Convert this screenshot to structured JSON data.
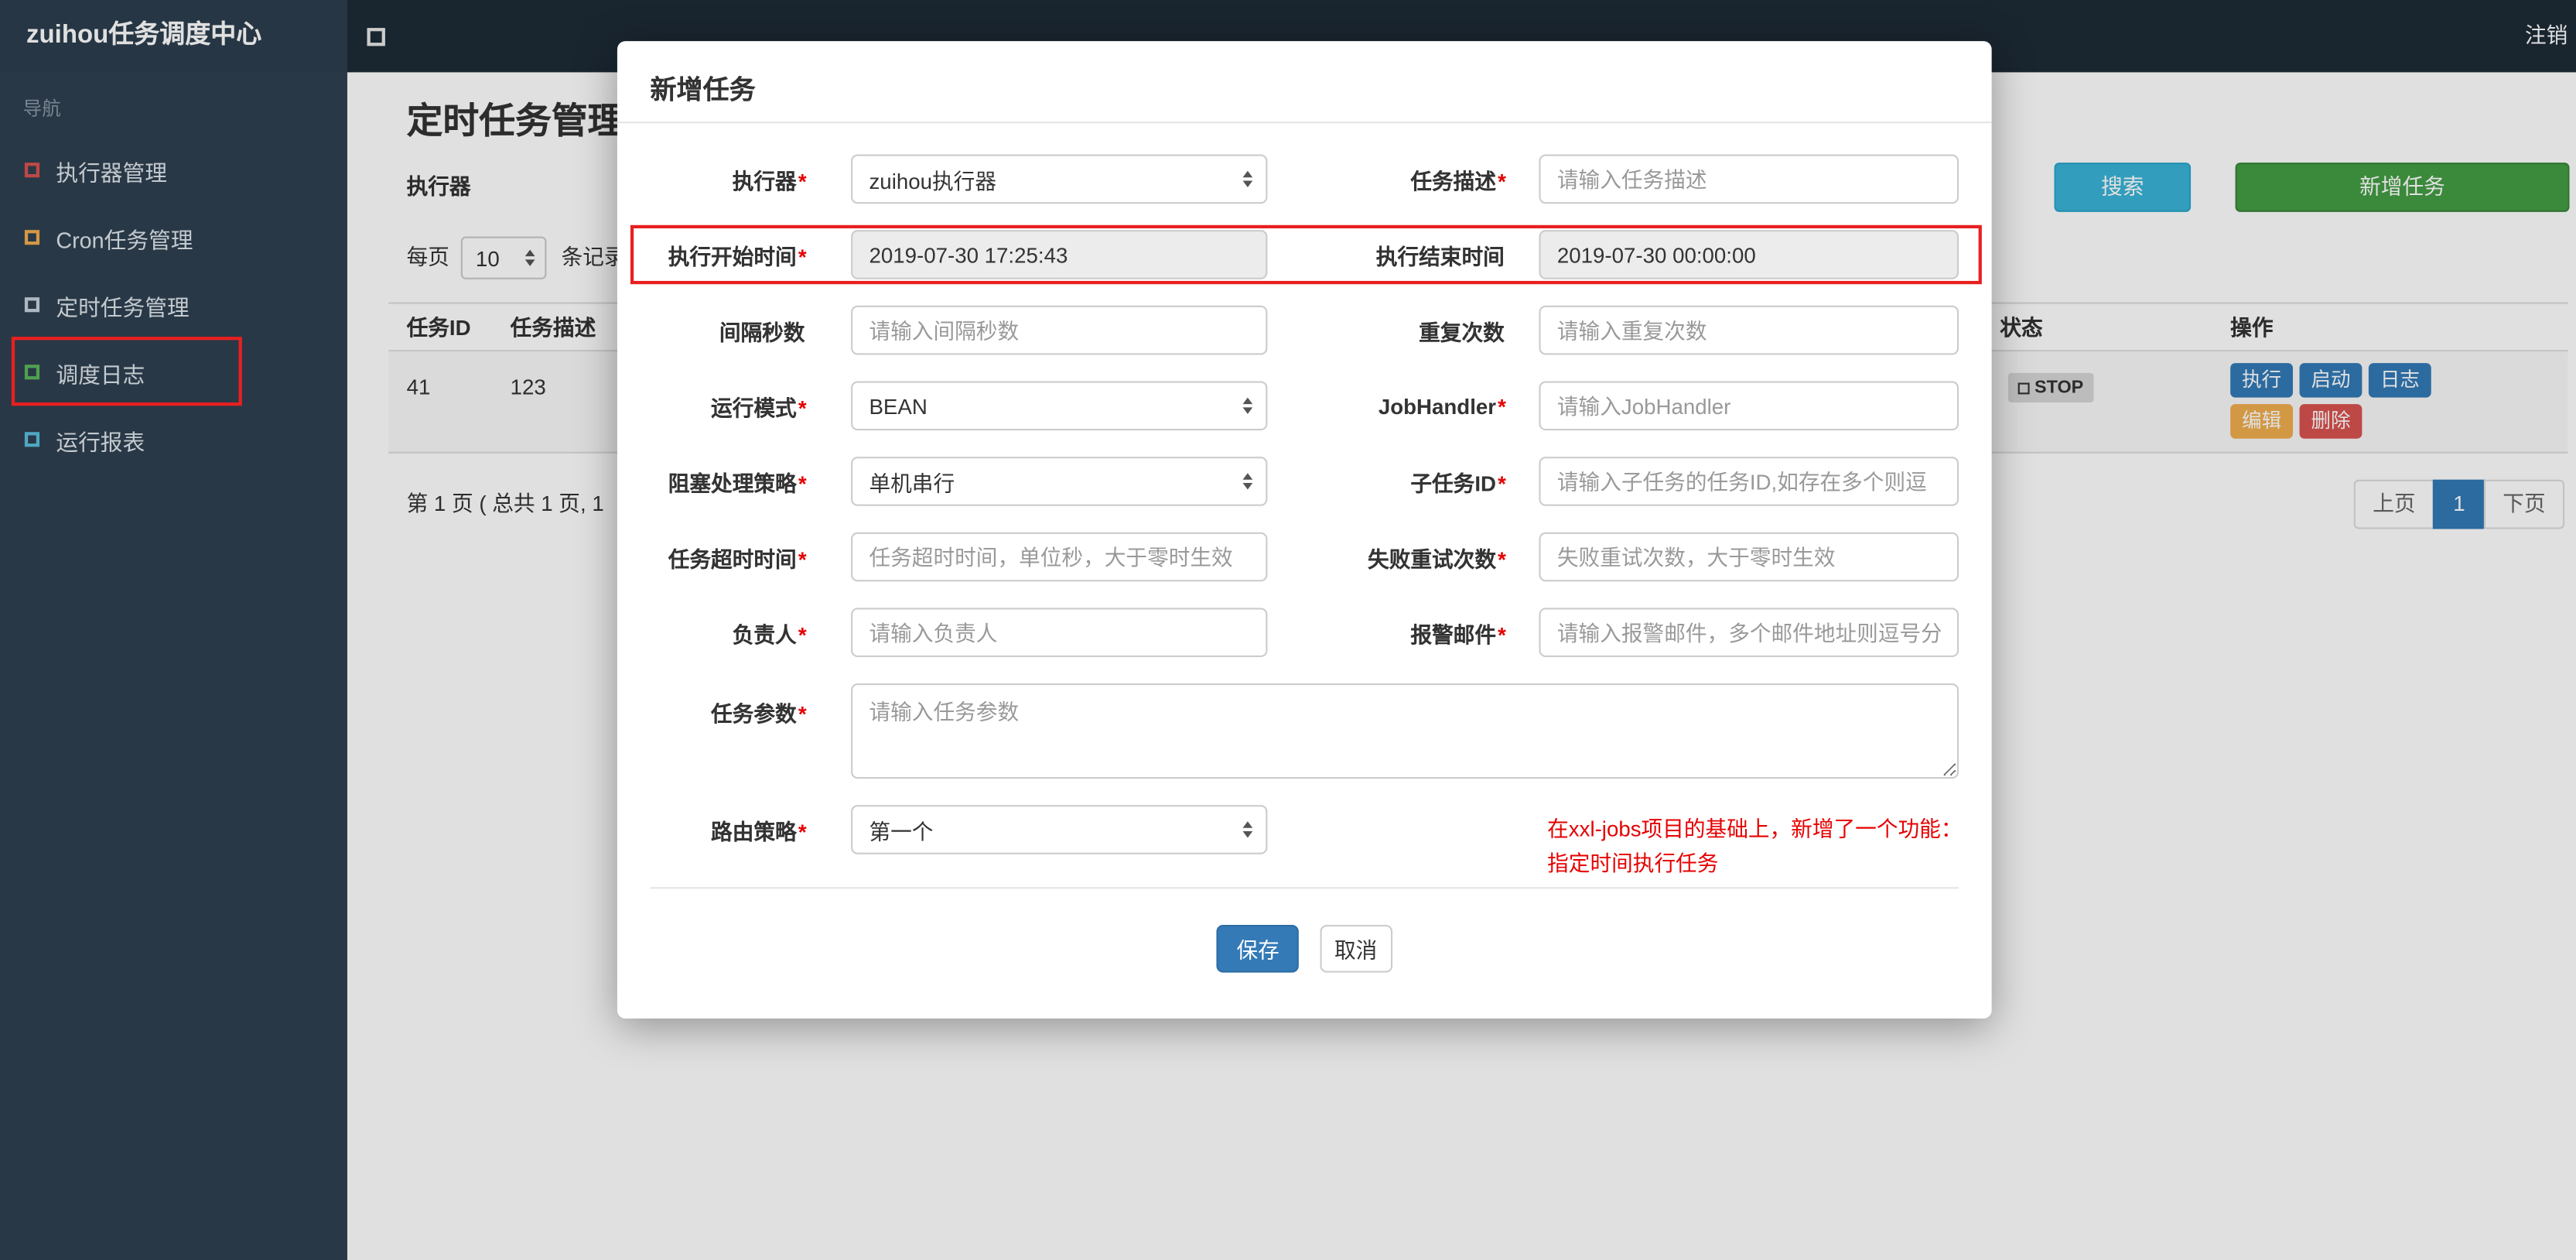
{
  "palette": {
    "navbar_bg": "#1d2b36",
    "brand_bg": "#2c3e4e",
    "sidebar_bg": "#2f4050",
    "accent_blue": "#337ab7",
    "success_green": "#449d44",
    "info_teal": "#39b3d7",
    "warning_orange": "#f0ad4e",
    "danger_red": "#d9534f",
    "annotation_red": "#e82020"
  },
  "navbar": {
    "brand": "zuihou任务调度中心",
    "logout": "注销"
  },
  "sidebar": {
    "section_label": "导航",
    "items": [
      {
        "label": "执行器管理",
        "icon_color": "#d9534f"
      },
      {
        "label": "Cron任务管理",
        "icon_color": "#f0ad4e"
      },
      {
        "label": "定时任务管理",
        "icon_color": "#c8d2dc",
        "active": true
      },
      {
        "label": "调度日志",
        "icon_color": "#5cb85c"
      },
      {
        "label": "运行报表",
        "icon_color": "#5bc0de"
      }
    ]
  },
  "page": {
    "title": "定时任务管理",
    "filter_label": "执行器",
    "search_button": "搜索",
    "add_button": "新增任务",
    "per_page": {
      "label": "每页",
      "value": "10",
      "suffix": "条记录"
    },
    "table": {
      "headers": {
        "id": "任务ID",
        "desc": "任务描述",
        "status": "状态",
        "ops": "操作"
      },
      "row": {
        "id": "41",
        "desc": "123",
        "status": "STOP",
        "buttons": {
          "execute": "执行",
          "start": "启动",
          "log": "日志",
          "edit": "编辑",
          "delete": "删除"
        }
      }
    },
    "pagination": {
      "summary": "第 1 页 ( 总共 1 页, 1",
      "prev": "上页",
      "current": "1",
      "next": "下页"
    }
  },
  "modal": {
    "title": "新增任务",
    "rows": [
      {
        "left": {
          "label": "执行器",
          "required": "*",
          "value": "zuihou执行器"
        },
        "right": {
          "label": "任务描述",
          "required": "*",
          "placeholder": "请输入任务描述"
        }
      },
      {
        "left": {
          "label": "执行开始时间",
          "required": "*",
          "value": "2019-07-30 17:25:43"
        },
        "right": {
          "label": "执行结束时间",
          "required": "",
          "value": "2019-07-30 00:00:00"
        }
      },
      {
        "left": {
          "label": "间隔秒数",
          "required": "",
          "placeholder": "请输入间隔秒数"
        },
        "right": {
          "label": "重复次数",
          "required": "",
          "placeholder": "请输入重复次数"
        }
      },
      {
        "left": {
          "label": "运行模式",
          "required": "*",
          "value": "BEAN"
        },
        "right": {
          "label": "JobHandler",
          "required": "*",
          "placeholder": "请输入JobHandler"
        }
      },
      {
        "left": {
          "label": "阻塞处理策略",
          "required": "*",
          "value": "单机串行"
        },
        "right": {
          "label": "子任务ID",
          "required": "*",
          "placeholder": "请输入子任务的任务ID,如存在多个则逗"
        }
      },
      {
        "left": {
          "label": "任务超时时间",
          "required": "*",
          "placeholder": "任务超时时间，单位秒，大于零时生效"
        },
        "right": {
          "label": "失败重试次数",
          "required": "*",
          "placeholder": "失败重试次数，大于零时生效"
        }
      },
      {
        "left": {
          "label": "负责人",
          "required": "*",
          "placeholder": "请输入负责人"
        },
        "right": {
          "label": "报警邮件",
          "required": "*",
          "placeholder": "请输入报警邮件，多个邮件地址则逗号分"
        }
      }
    ],
    "params": {
      "label": "任务参数",
      "required": "*",
      "placeholder": "请输入任务参数"
    },
    "route": {
      "label": "路由策略",
      "required": "*",
      "value": "第一个"
    },
    "note": "在xxl-jobs项目的基础上，新增了一个功能：指定时间执行任务",
    "save": "保存",
    "cancel": "取消"
  }
}
